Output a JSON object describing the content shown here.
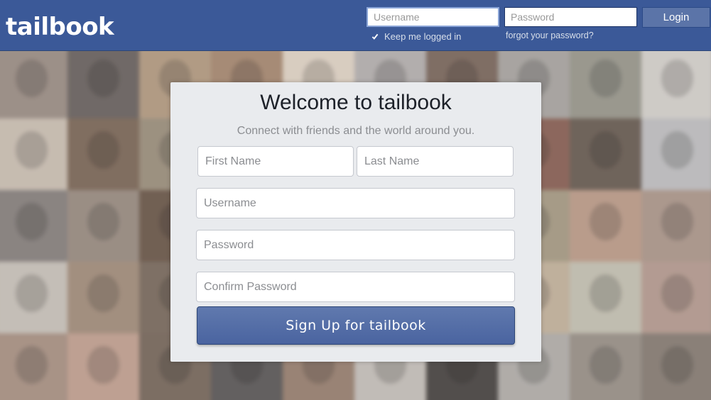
{
  "header": {
    "logo_text": "tailbook",
    "username_placeholder": "Username",
    "password_placeholder": "Password",
    "login_label": "Login",
    "keep_logged_in_label": "Keep me logged in",
    "keep_logged_in_checked": true,
    "forgot_password_label": "forgot your password?"
  },
  "signup": {
    "title": "Welcome to tailbook",
    "subtitle": "Connect with friends and the world around you.",
    "first_name_placeholder": "First Name",
    "last_name_placeholder": "Last Name",
    "username_placeholder": "Username",
    "password_placeholder": "Password",
    "confirm_password_placeholder": "Confirm Password",
    "button_label": "Sign Up for tailbook"
  },
  "colors": {
    "brand_blue": "#3b5998",
    "panel_background": "#e9ebee",
    "button_blue": "#5b74a8"
  },
  "background": {
    "description_icon": "photo-grid",
    "tiles": [
      "#8f8178",
      "#5d5552",
      "#a78e74",
      "#9a7b63",
      "#d3c6b8",
      "#a8a3a2",
      "#6e5a4f",
      "#9c9894",
      "#8c8a7f",
      "#c8c4bf",
      "#bfb3a6",
      "#6f5a4a",
      "#8f826f",
      "#c0b7ae",
      "#d4cdc4",
      "#cfcac6",
      "#7e5e54",
      "#7d5347",
      "#5c4f45",
      "#b3b2b4",
      "#7a7370",
      "#8d7f74",
      "#5e4a3c",
      "#c9c2bb",
      "#dedad6",
      "#d7d2cd",
      "#4a3a33",
      "#9a8e77",
      "#b08f7c",
      "#a08a7e",
      "#bcb5ad",
      "#96806e",
      "#6d5d50",
      "#d0c9c2",
      "#e0dcd8",
      "#d5d0cc",
      "#a87b6c",
      "#b7a58f",
      "#b8b4a5",
      "#a98e83",
      "#9c8476",
      "#b59383",
      "#6a5a4e",
      "#4e4a4a",
      "#8b7262",
      "#b9b3ad",
      "#3b3634",
      "#a5a19d",
      "#8c837a",
      "#7a6f66"
    ]
  }
}
